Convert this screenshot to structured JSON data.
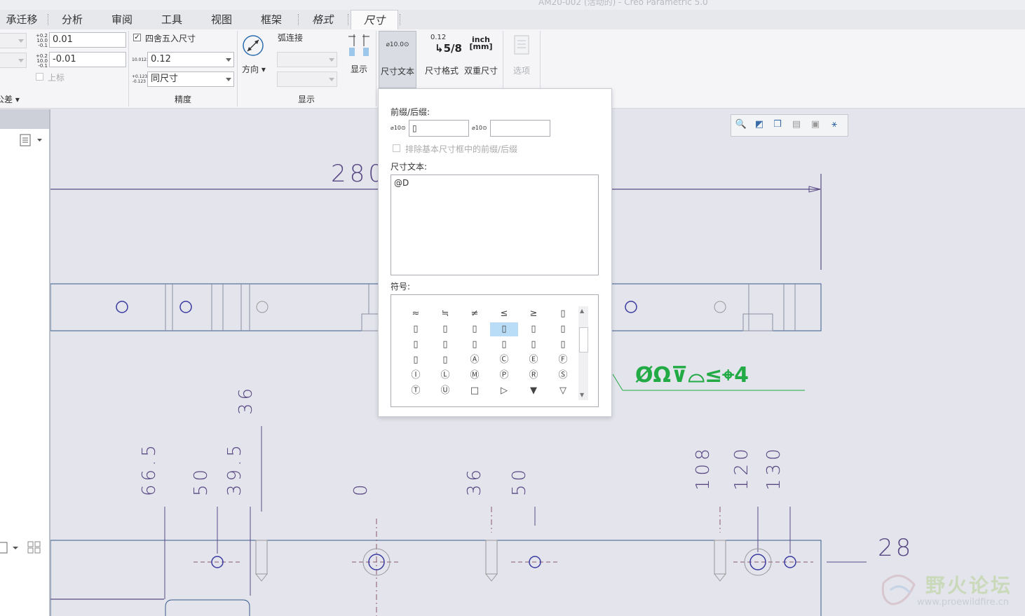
{
  "window": {
    "title": "AM20-002 (活动的) - Creo Parametric 5.0"
  },
  "tabs": [
    {
      "label": "承迁移"
    },
    {
      "label": "分析"
    },
    {
      "label": "审阅"
    },
    {
      "label": "工具"
    },
    {
      "label": "视图"
    },
    {
      "label": "框架"
    },
    {
      "label": "格式"
    },
    {
      "label": "尺寸"
    }
  ],
  "ribbon": {
    "tolerance": {
      "upper_icon": "+0.2\n10.0\n-0.1",
      "upper_value": "0.01",
      "lower_value": "-0.01",
      "upper_label": "上标",
      "group_label": "公差"
    },
    "precision": {
      "round_label": "四舍五入尺寸",
      "round_checked": true,
      "decimal_icon": "10.0123",
      "decimal_value": "0.12",
      "tol_icon": "+0.123\n-0.123",
      "tol_value": "同尺寸",
      "group_label": "精度"
    },
    "display": {
      "direction_label": "方向",
      "arc_label": "弧连接",
      "show_label": "显示",
      "group_label": "显示"
    },
    "buttons": {
      "dim_text": "尺寸文本",
      "dim_text_icon": "⌀10.0⊙",
      "dim_format": "尺寸格式",
      "dim_format_icon_top": "0.12",
      "dim_format_icon_bottom": "5/8",
      "dual_dim": "双重尺寸",
      "dual_icon_top": "inch",
      "dual_icon_bottom": "[mm]",
      "options": "选项"
    }
  },
  "popup": {
    "prefix_suffix_label": "前缀/后缀:",
    "prefix_icon": "⌀10⊙",
    "suffix_icon": "⌀10⊙",
    "prefix_value": "▯",
    "suffix_value": "",
    "exclude_label": "排除基本尺寸框中的前缀/后缀",
    "dim_text_label": "尺寸文本:",
    "dim_text_value": "@D",
    "symbols_label": "符号:",
    "symbols": [
      [
        "≈",
        "≒",
        "≠",
        "≤",
        "≥",
        "▯"
      ],
      [
        "▯",
        "▯",
        "▯",
        "▯",
        "▯",
        "▯"
      ],
      [
        "▯",
        "▯",
        "▯",
        "▯",
        "▯",
        "▯"
      ],
      [
        "▯",
        "▯",
        "Ⓐ",
        "Ⓒ",
        "Ⓔ",
        "Ⓕ"
      ],
      [
        "Ⓘ",
        "Ⓛ",
        "Ⓜ",
        "Ⓟ",
        "Ⓡ",
        "Ⓢ"
      ],
      [
        "Ⓣ",
        "Ⓤ",
        "□",
        "▷",
        "▼",
        "▽"
      ]
    ],
    "selected_symbol": [
      1,
      3
    ]
  },
  "drawing": {
    "top_dim": "280",
    "green_annotation": "ØΩ⊽⌓≤⌖4",
    "vertical_dims_left": [
      "66.5",
      "50",
      "39.5",
      "36"
    ],
    "vertical_dims_mid": [
      "0",
      "36",
      "50"
    ],
    "vertical_dims_right": [
      "108",
      "120",
      "130"
    ],
    "right_dim": "28"
  },
  "watermark": {
    "text": "野火论坛",
    "url": "www.proewildfire.cn"
  }
}
